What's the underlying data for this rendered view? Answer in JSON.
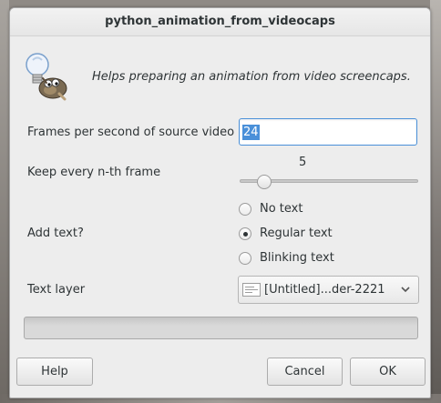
{
  "window": {
    "title": "python_animation_from_videocaps"
  },
  "header": {
    "description": "Helps preparing an animation from video screencaps.",
    "icon": "gimp-wilber-lightbulb-icon"
  },
  "fields": {
    "fps": {
      "label": "Frames per second of source video",
      "value": "24"
    },
    "nth_frame": {
      "label": "Keep every n-th frame",
      "value": "5",
      "min": 1,
      "max": 30
    },
    "add_text": {
      "label": "Add text?",
      "options": [
        {
          "label": "No text",
          "selected": false
        },
        {
          "label": "Regular text",
          "selected": true
        },
        {
          "label": "Blinking text",
          "selected": false
        }
      ]
    },
    "text_layer": {
      "label": "Text layer",
      "value": "[Untitled]...der-2221"
    }
  },
  "progress": {
    "fraction": 0
  },
  "buttons": {
    "help": "Help",
    "cancel": "Cancel",
    "ok": "OK"
  },
  "colors": {
    "accent": "#4a90d9",
    "dialog_bg": "#ededed"
  }
}
